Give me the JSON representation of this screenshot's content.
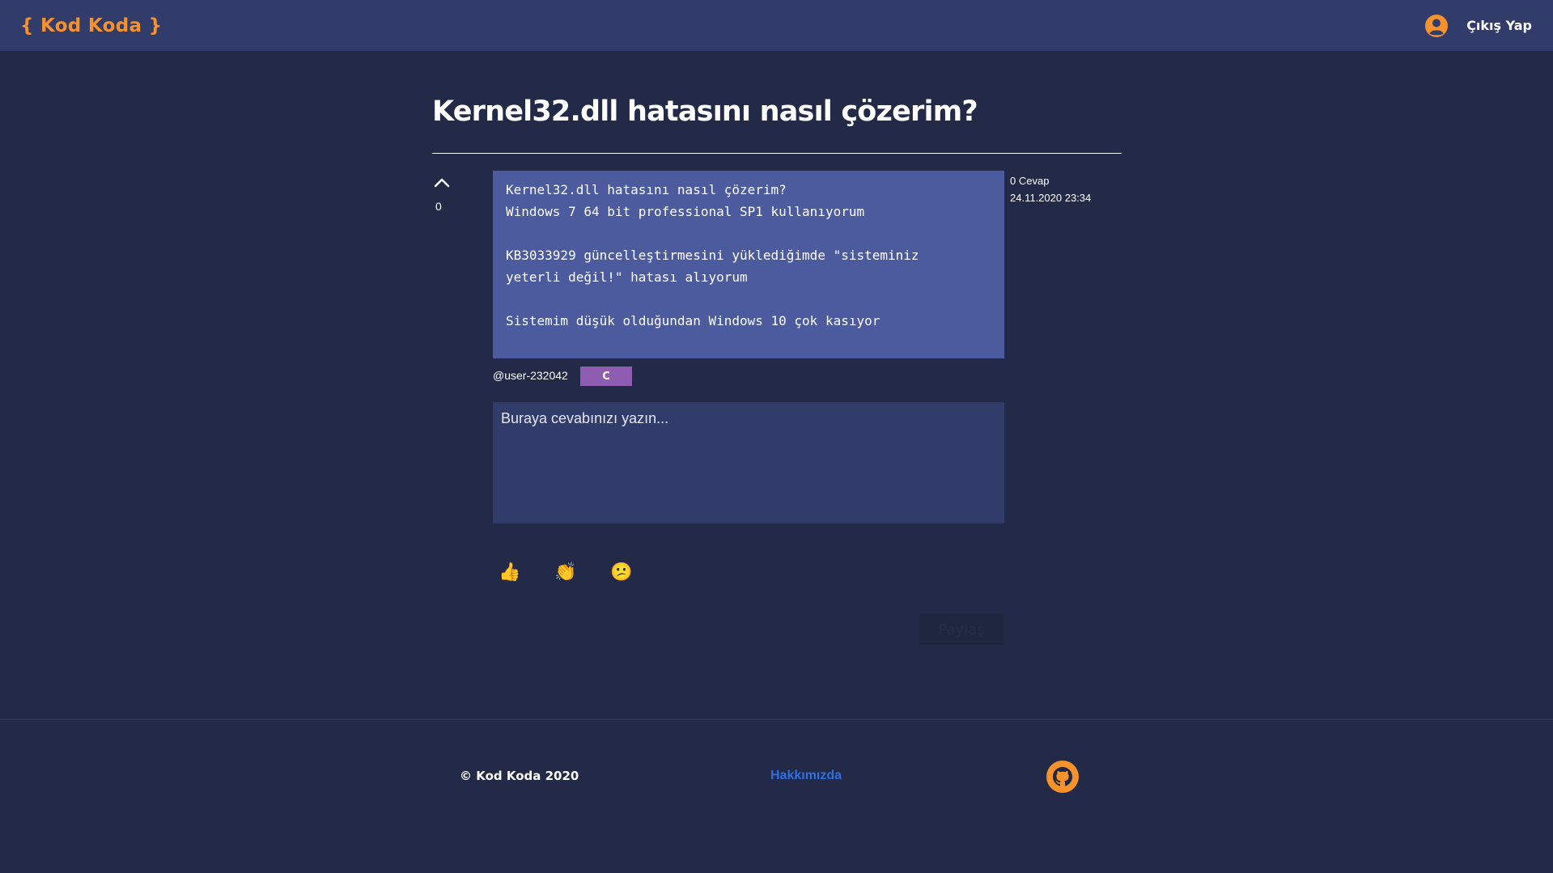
{
  "nav": {
    "logo": "{ Kod Koda }",
    "logout_label": "Çıkış Yap",
    "user_icon": "user-circle-icon"
  },
  "question": {
    "title": "Kernel32.dll hatasını nasıl çözerim?",
    "body": "Kernel32.dll hatasını nasıl çözerim?\nWindows 7 64 bit professional SP1 kullanıyorum\n\nKB3033929 güncelleştirmesini yüklediğimde \"sisteminiz\nyeterli değil!\" hatası alıyorum\n\nSistemim düşük olduğundan Windows 10 çok kasıyor",
    "votes": "0",
    "answers": "0 Cevap",
    "date": "24.11.2020 23:34",
    "author": "@user-232042",
    "tag": "C"
  },
  "answer_box": {
    "placeholder": "Buraya cevabınızı yazın..."
  },
  "reactions": {
    "thumbs_up": "👍",
    "clap": "👏",
    "confused": "😕"
  },
  "share_label": "Paylaş",
  "footer": {
    "copyright": "© Kod Koda 2020",
    "about": "Hakkımızda",
    "github_icon": "github-icon"
  },
  "colors": {
    "background": "#222a48",
    "navbar": "#323c6a",
    "accent": "#f5922b",
    "question_body": "#4c5b9e",
    "tag": "#8e5cb0",
    "link": "#2f6fe0"
  }
}
